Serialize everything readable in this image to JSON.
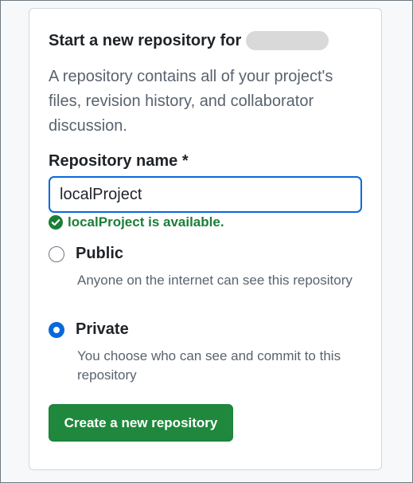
{
  "card": {
    "title": "Start a new repository for",
    "description": "A repository contains all of your project's files, revision history, and collaborator discussion.",
    "name_field": {
      "label": "Repository name *",
      "value": "localProject",
      "availability": "localProject is available."
    },
    "visibility": [
      {
        "label": "Public",
        "note": "Anyone on the internet can see this repository",
        "selected": false
      },
      {
        "label": "Private",
        "note": "You choose who can see and commit to this repository",
        "selected": true
      }
    ],
    "create_label": "Create a new repository"
  },
  "colors": {
    "accent": "#0969da",
    "success": "#1a7f37",
    "button": "#1f883d"
  },
  "icons": {
    "availability": "check-circle-icon"
  }
}
